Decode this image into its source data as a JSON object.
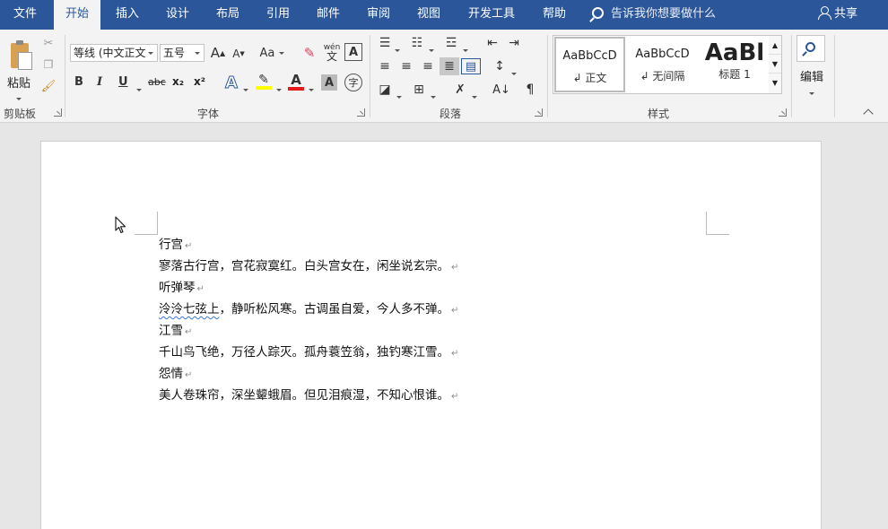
{
  "tabs": {
    "file": "文件",
    "home": "开始",
    "insert": "插入",
    "design": "设计",
    "layout": "布局",
    "references": "引用",
    "mailings": "邮件",
    "review": "审阅",
    "view": "视图",
    "developer": "开发工具",
    "help": "帮助"
  },
  "tell_me": "告诉我你想要做什么",
  "share": "共享",
  "clipboard": {
    "paste": "粘贴",
    "group": "剪贴板"
  },
  "font": {
    "name": "等线 (中文正文",
    "size": "五号",
    "grow": "A",
    "shrink": "A",
    "change_case": "Aa",
    "phonetic": "wén",
    "bold": "B",
    "italic": "I",
    "underline": "U",
    "strike": "abc",
    "subscript": "x₂",
    "superscript": "x²",
    "group": "字体",
    "enclose": "字"
  },
  "paragraph": {
    "group": "段落"
  },
  "styles": {
    "group": "样式",
    "items": [
      {
        "sample": "AaBbCcD",
        "name": "↲ 正文"
      },
      {
        "sample": "AaBbCcD",
        "name": "↲ 无间隔"
      },
      {
        "sample": "AaBl",
        "name": "标题 1"
      }
    ]
  },
  "editing": {
    "label": "编辑"
  },
  "document": {
    "lines": [
      "行宫",
      "寥落古行宫，宫花寂寞红。白头宫女在，闲坐说玄宗。",
      "听弹琴",
      "泠泠七弦上，静听松风寒。古调虽自爱，今人多不弹。",
      "江雪",
      "千山鸟飞绝，万径人踪灭。孤舟蓑笠翁，独钓寒江雪。",
      "怨情",
      "美人卷珠帘，深坐颦蛾眉。但见泪痕湿，不知心恨谁。"
    ],
    "squiggle_word": "泠泠七弦上",
    "paragraph_mark": "↵"
  }
}
